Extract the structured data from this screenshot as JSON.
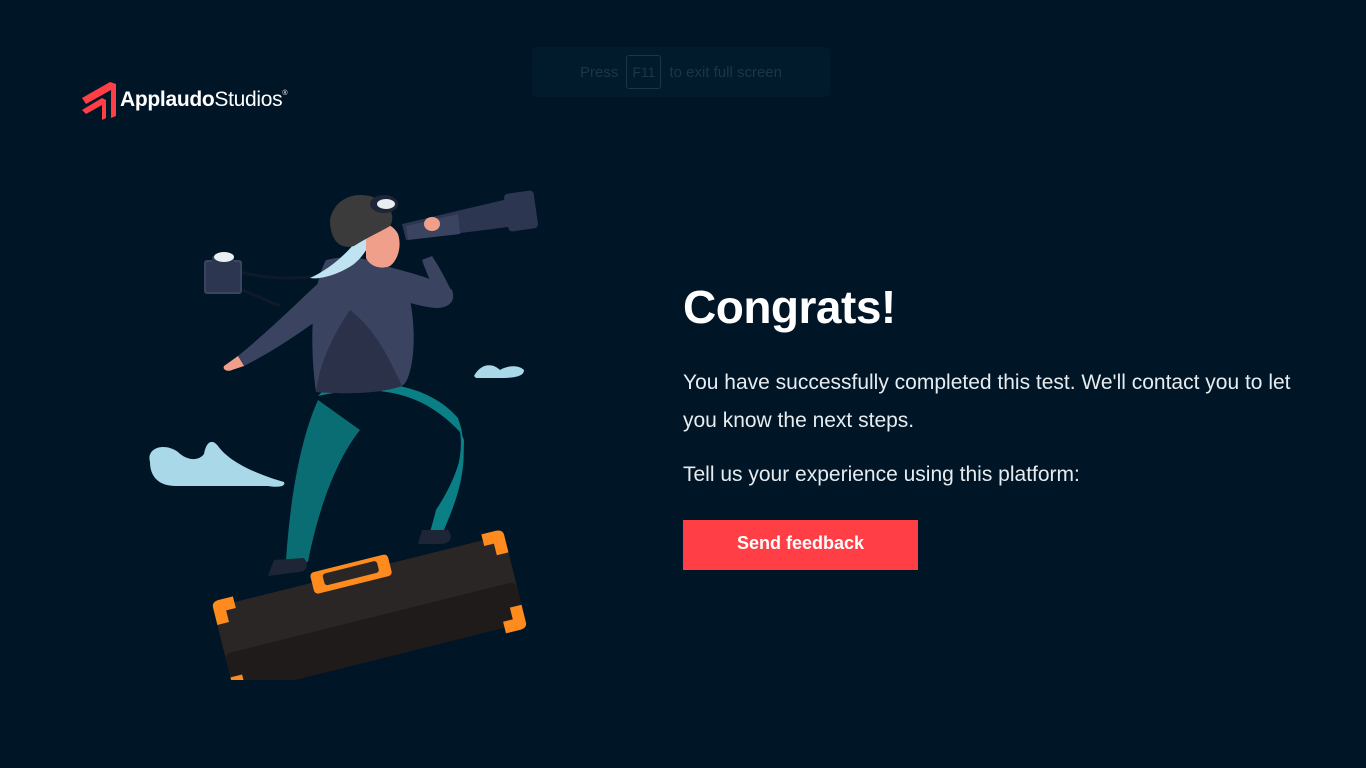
{
  "fullscreen_hint": {
    "prefix": "Press",
    "key": "F11",
    "suffix": "to exit full screen"
  },
  "logo": {
    "bold": "Applaudo",
    "regular": "Studios",
    "mark": "®",
    "icon": "applaudo-logo-icon",
    "accent_color": "#ff3f45"
  },
  "illustration": {
    "icon": "explorer-with-telescope-on-suitcase-illustration"
  },
  "main": {
    "title": "Congrats!",
    "message": "You have successfully completed this test. We'll contact you to let you know the next steps.",
    "prompt": "Tell us your experience using this platform:",
    "button_label": "Send feedback"
  },
  "colors": {
    "background": "#001526",
    "button": "#ff3f45",
    "text": "#ffffff"
  }
}
